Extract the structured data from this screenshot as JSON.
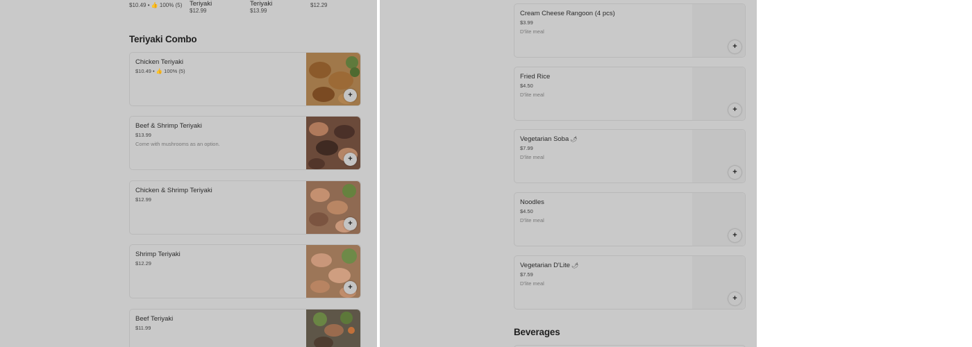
{
  "left": {
    "carousel": [
      {
        "title": "",
        "price": "$10.49 • 👍 100% (5)"
      },
      {
        "title": "Teriyaki",
        "price": "$12.99"
      },
      {
        "title": "Teriyaki",
        "price": "$13.99"
      },
      {
        "title": "",
        "price": "$12.29"
      }
    ],
    "section_title": "Teriyaki Combo",
    "items": [
      {
        "name": "Chicken Teriyaki",
        "price": "$10.49 • 👍 100% (5)",
        "desc": "",
        "add": "+"
      },
      {
        "name": "Beef & Shrimp Teriyaki",
        "price": "$13.99",
        "desc": "Come with mushrooms as an option.",
        "add": "+"
      },
      {
        "name": "Chicken & Shrimp Teriyaki",
        "price": "$12.99",
        "desc": "",
        "add": "+"
      },
      {
        "name": "Shrimp Teriyaki",
        "price": "$12.29",
        "desc": "",
        "add": "+"
      },
      {
        "name": "Beef Teriyaki",
        "price": "$11.99",
        "desc": "",
        "add": "+"
      }
    ]
  },
  "right": {
    "items": [
      {
        "name": "Cream Cheese Rangoon (4 pcs)",
        "price": "$3.99",
        "desc": "D'lite meal",
        "add": "+",
        "leaf": ""
      },
      {
        "name": "Fried Rice",
        "price": "$4.50",
        "desc": "D'lite meal",
        "add": "+",
        "leaf": ""
      },
      {
        "name": "Vegetarian Soba",
        "price": "$7.99",
        "desc": "D'lite meal",
        "add": "+",
        "leaf": "🌶"
      },
      {
        "name": "Noodles",
        "price": "$4.50",
        "desc": "D'lite meal",
        "add": "+",
        "leaf": ""
      },
      {
        "name": "Vegetarian D'Lite",
        "price": "$7.59",
        "desc": "D'lite meal",
        "add": "+",
        "leaf": "🌶"
      }
    ],
    "section_title": "Beverages"
  },
  "colors": {
    "overlay": "#c9c9c9",
    "border": "#b9b9b9",
    "divider": "#ffffff"
  }
}
